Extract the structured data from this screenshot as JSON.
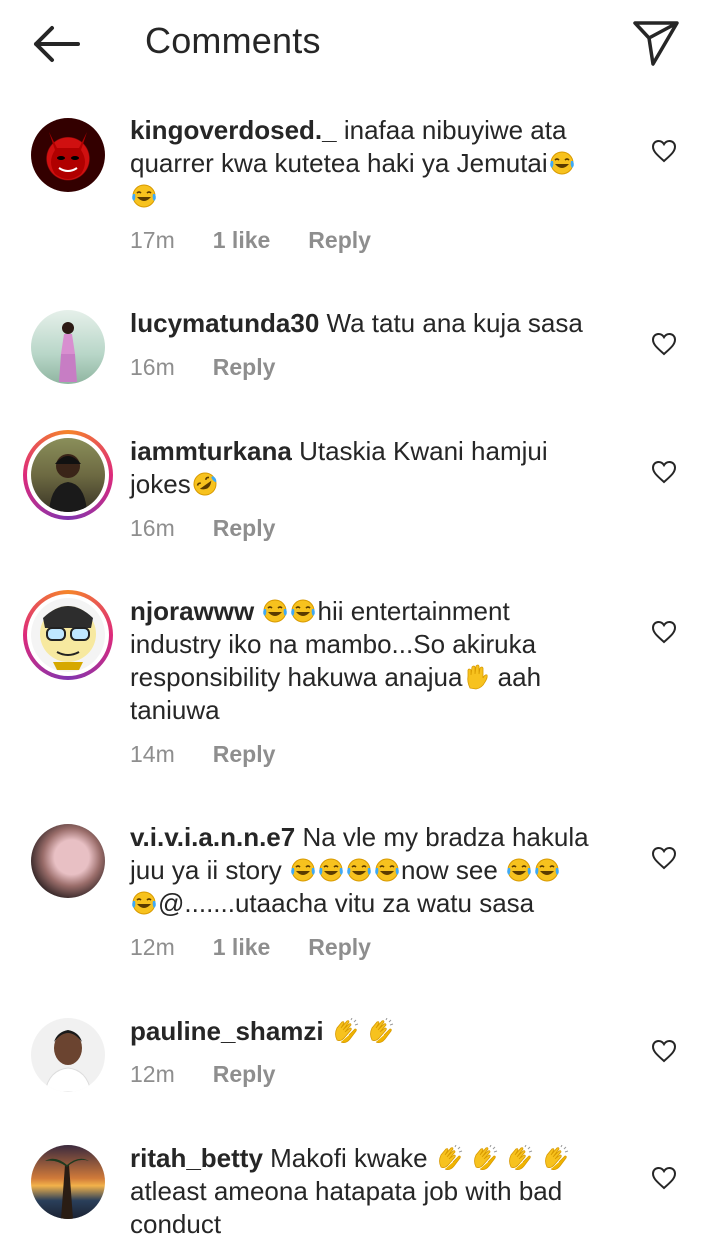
{
  "header": {
    "title": "Comments"
  },
  "comments": [
    {
      "username": "kingoverdosed._",
      "text_1": " inafaa nibuyiwe ata",
      "text_2": "quarrer kwa kutetea haki ya Jemutai",
      "time": "17m",
      "likes": "1 like",
      "reply": "Reply"
    },
    {
      "username": "lucymatunda30",
      "text_1": " Wa tatu ana kuja sasa",
      "time": "16m",
      "reply": "Reply"
    },
    {
      "username": "iammturkana",
      "text_1": " Utaskia Kwani hamjui",
      "text_2": "jokes",
      "time": "16m",
      "reply": "Reply"
    },
    {
      "username": "njorawww",
      "text_1": "hii entertainment",
      "text_2": "industry iko na mambo...So akiruka",
      "text_3": "responsibility hakuwa anajua",
      "text_3b": " aah",
      "text_4": "taniuwa",
      "time": "14m",
      "reply": "Reply"
    },
    {
      "username": "v.i.v.i.a.n.n.e7",
      "text_1": " Na vle my bradza hakula",
      "text_2a": "juu ya ii story ",
      "text_2b": "now see ",
      "text_3": "@.......utaacha vitu za watu sasa",
      "time": "12m",
      "likes": "1 like",
      "reply": "Reply"
    },
    {
      "username": "pauline_shamzi",
      "time": "12m",
      "reply": "Reply"
    },
    {
      "username": "ritah_betty",
      "text_1": " Makofi kwake ",
      "text_2": "atleast ameona hatapata job with bad",
      "text_3": "conduct"
    }
  ],
  "icons": {
    "back": "arrow-left-icon",
    "send": "paper-plane-icon",
    "like": "heart-outline-icon",
    "laugh": "face-with-tears-of-joy-emoji",
    "rofl": "rolling-on-floor-laughing-emoji",
    "hand": "raised-hand-emoji",
    "clap": "clapping-hands-emoji"
  },
  "colors": {
    "text": "#262626",
    "meta": "#8e8e8e",
    "story_ring": "#dd2a7b"
  }
}
